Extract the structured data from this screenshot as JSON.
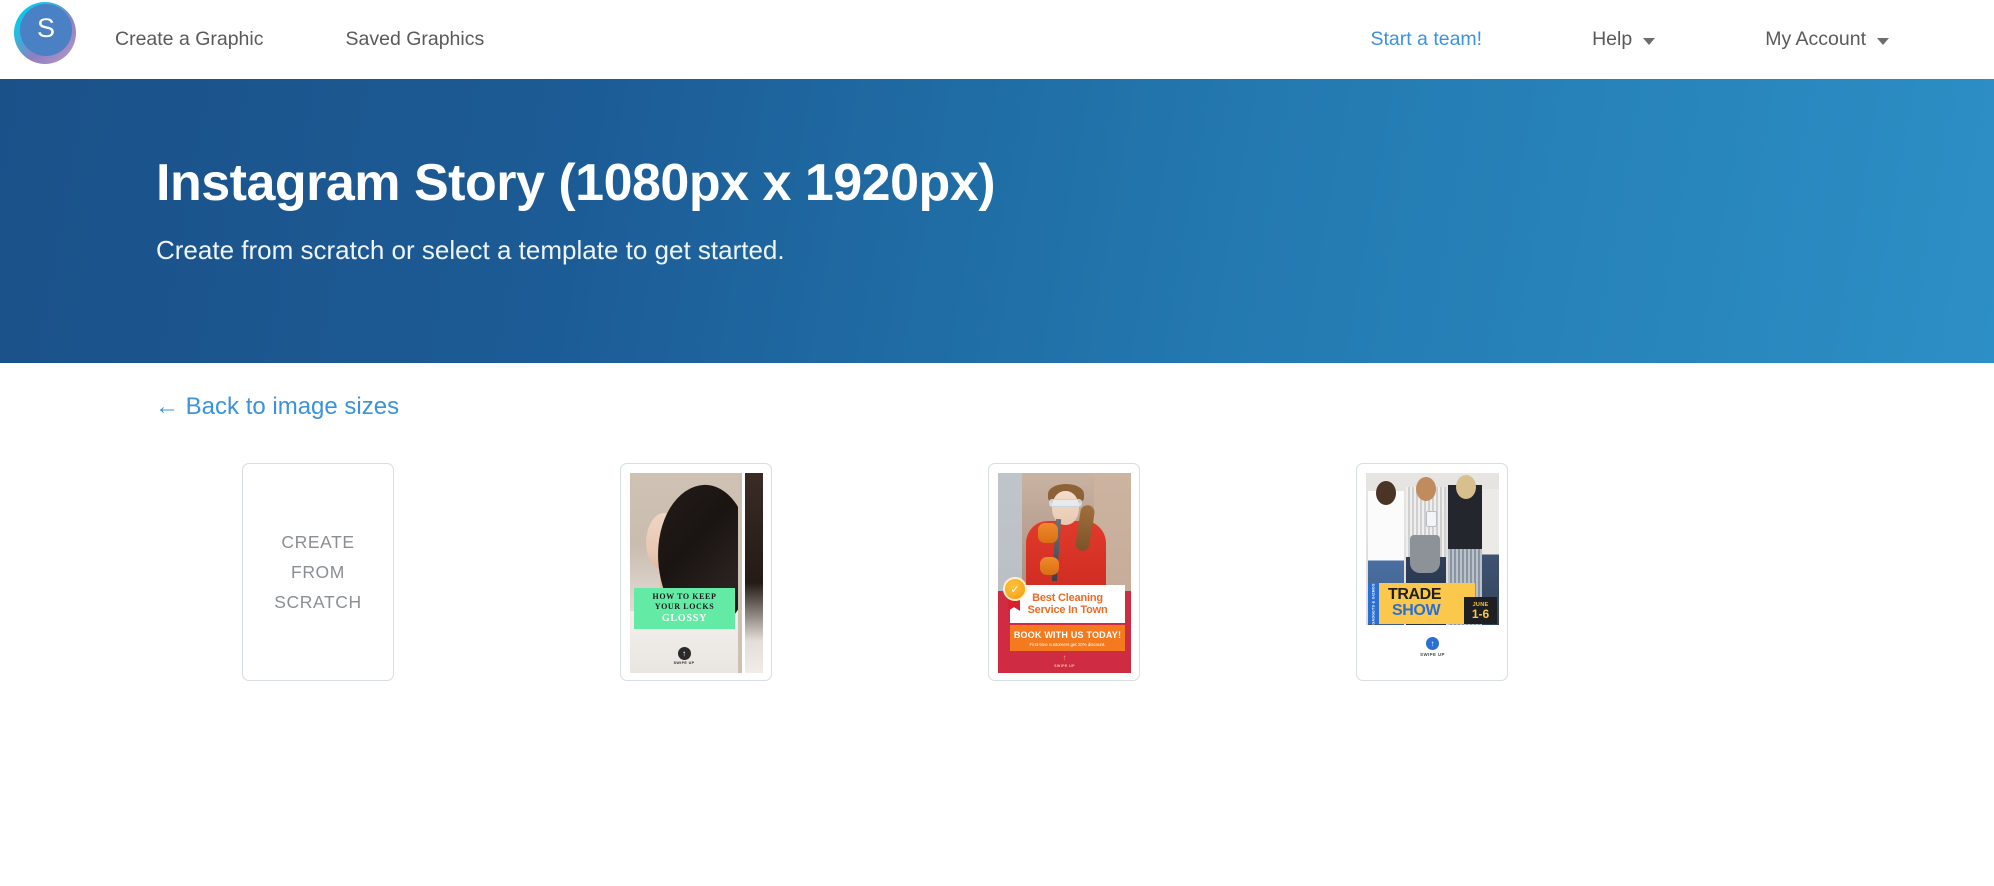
{
  "nav": {
    "logo_letter": "S",
    "left_items": [
      {
        "label": "Create a Graphic",
        "name": "create-a-graphic"
      },
      {
        "label": "Saved Graphics",
        "name": "saved-graphics"
      }
    ],
    "right_items": [
      {
        "label": "Start a team!",
        "name": "start-a-team"
      },
      {
        "label": "Help",
        "name": "help"
      },
      {
        "label": "My Account",
        "name": "my-account"
      }
    ]
  },
  "hero": {
    "title": "Instagram Story (1080px x 1920px)",
    "subtitle": "Create from scratch or select a template to get started.",
    "gradient_from": "#1b5189",
    "gradient_to": "#2c8fc5"
  },
  "main": {
    "back_link": "← Back to image sizes",
    "link_color": "#3b93dd"
  },
  "templates": [
    {
      "name": "create-from-scratch",
      "line1": "CREATE",
      "line2": "FROM",
      "line3": "SCRATCH"
    },
    {
      "name": "how-to-keep-your-locks-glossy",
      "headline_1": "HOW TO KEEP",
      "headline_2": "YOUR LOCKS",
      "headline_3": "GLOSSY",
      "swipe_label": "SWIPE UP",
      "band_color": "#63eaa5"
    },
    {
      "name": "best-cleaning-service-in-town",
      "headline_1": "Best Cleaning",
      "headline_2": "Service In Town",
      "cta": "BOOK WITH US TODAY!",
      "subcta": "First-time customers get 20% discount.",
      "swipe_label": "SWIPE UP",
      "bg_color": "#cf2b43",
      "accent_color": "#f47a20"
    },
    {
      "name": "trade-show",
      "side_label": "GADGETS & GIZMOS",
      "headline_1": "TRADE",
      "headline_2": "SHOW",
      "date_month": "JUNE",
      "date_days": "1-6",
      "swipe_label": "SWIPE UP",
      "band_color": "#fbc84b",
      "accent_color": "#2a6fd4"
    }
  ],
  "icons": {
    "swipe_up_arrow": "↑",
    "check": "✓"
  }
}
